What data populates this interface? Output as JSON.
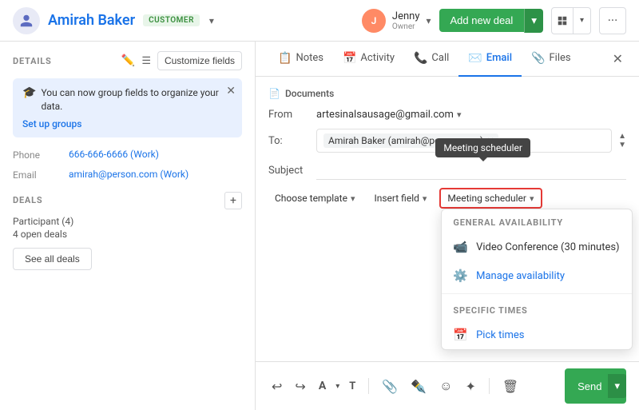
{
  "header": {
    "contact_name": "Amirah Baker",
    "customer_badge": "CUSTOMER",
    "owner_name": "Jenny",
    "owner_role": "Owner",
    "add_deal_label": "Add new deal"
  },
  "left_panel": {
    "details_label": "DETAILS",
    "customize_label": "Customize fields",
    "notification": {
      "text": "You can now group fields to organize your data.",
      "setup_link": "Set up groups"
    },
    "fields": [
      {
        "label": "Phone",
        "value": "666-666-6666 (Work)"
      },
      {
        "label": "Email",
        "value": "amirah@person.com (Work)"
      }
    ],
    "deals": {
      "label": "DEALS",
      "participant_text": "Participant (4)",
      "open_deals": "4 open deals",
      "see_all_label": "See all deals"
    }
  },
  "right_panel": {
    "tabs": [
      {
        "label": "Notes",
        "icon": "📋"
      },
      {
        "label": "Activity",
        "icon": "📅"
      },
      {
        "label": "Call",
        "icon": "📞"
      },
      {
        "label": "Email",
        "icon": "✉️",
        "active": true
      },
      {
        "label": "Files",
        "icon": "📎"
      }
    ],
    "email": {
      "section_title": "Documents",
      "from_label": "From",
      "from_value": "artesinalsausage@gmail.com",
      "to_label": "To:",
      "to_value": "Amirah Baker (amirah@person.com)",
      "subject_label": "Subject",
      "subject_value": "",
      "tooltip_text": "Meeting scheduler",
      "choose_template_label": "Choose template",
      "insert_field_label": "Insert field",
      "meeting_scheduler_label": "Meeting scheduler",
      "dropdown": {
        "general_availability_title": "GENERAL AVAILABILITY",
        "video_conference_label": "Video Conference (30 minutes)",
        "manage_availability_label": "Manage availability",
        "specific_times_title": "SPECIFIC TIMES",
        "pick_times_label": "Pick times"
      }
    }
  }
}
